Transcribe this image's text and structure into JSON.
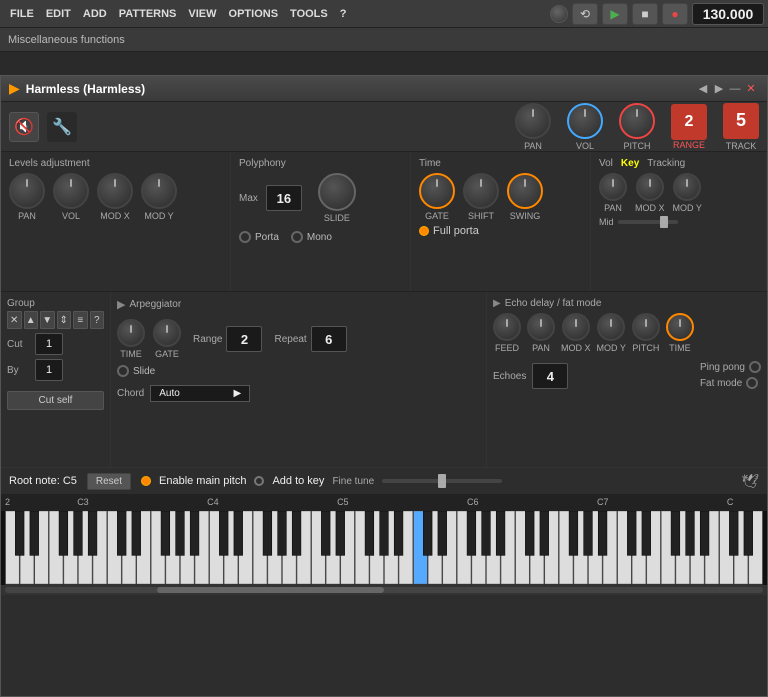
{
  "menubar": {
    "items": [
      "FILE",
      "EDIT",
      "ADD",
      "PATTERNS",
      "VIEW",
      "OPTIONS",
      "TOOLS",
      "?"
    ]
  },
  "misc_functions": "Miscellaneous functions",
  "transport": {
    "bpm": "130.000"
  },
  "plugin": {
    "title": "Harmless (Harmless)",
    "nav_prev": "◀",
    "nav_next": "▶",
    "minimize": "—",
    "close": "✕"
  },
  "top_knobs": {
    "pan_label": "PAN",
    "vol_label": "VOL",
    "pitch_label": "PITCH",
    "range_label": "RANGE",
    "track_label": "TRACK",
    "track_num": "5",
    "range_num": "2"
  },
  "levels": {
    "title": "Levels adjustment",
    "knobs": [
      "PAN",
      "VOL",
      "MOD X",
      "MOD Y"
    ]
  },
  "polyphony": {
    "title": "Polyphony",
    "max_label": "Max",
    "max_value": "16",
    "slide_label": "SLIDE",
    "porta_label": "Porta",
    "mono_label": "Mono"
  },
  "time": {
    "title": "Time",
    "knobs": [
      "GATE",
      "SHIFT",
      "SWING"
    ],
    "fullporta": "Full porta"
  },
  "vkt": {
    "vol_label": "Vol",
    "key_label": "Key",
    "tracking_label": "Tracking",
    "knobs": [
      "PAN",
      "MOD X",
      "MOD Y"
    ],
    "mid_label": "Mid"
  },
  "group": {
    "title": "Group",
    "cut_label": "Cut",
    "cut_value": "1",
    "by_label": "By",
    "by_value": "1",
    "cut_self": "Cut self",
    "toolbar": [
      "✕",
      "▲",
      "▼",
      "⇕",
      "≡",
      "?"
    ]
  },
  "arpeggiator": {
    "title": "Arpeggiator",
    "range_label": "Range",
    "range_value": "2",
    "repeat_label": "Repeat",
    "repeat_value": "6",
    "slide_label": "Slide",
    "chord_label": "Chord",
    "chord_value": "Auto",
    "knob_labels": [
      "TIME",
      "GATE"
    ]
  },
  "echo": {
    "title": "Echo delay / fat mode",
    "knob_labels": [
      "FEED",
      "PAN",
      "MOD X",
      "MOD Y",
      "PITCH",
      "TIME"
    ],
    "echoes_label": "Echoes",
    "echoes_value": "4",
    "ping_pong": "Ping pong",
    "fat_mode": "Fat mode"
  },
  "root_note": {
    "label": "Root note: C5",
    "reset": "Reset",
    "enable_pitch": "Enable main pitch",
    "add_to_key": "Add to key",
    "fine_tune": "Fine tune"
  },
  "piano": {
    "labels": [
      "2",
      "C3",
      "C4",
      "C5",
      "C6",
      "C7",
      "C"
    ]
  }
}
